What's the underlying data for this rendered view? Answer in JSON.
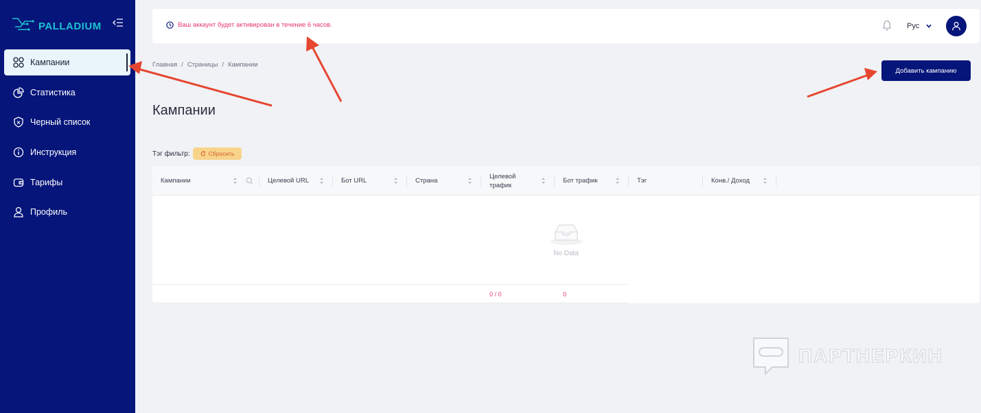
{
  "sidebar": {
    "logo_text": "PALLADIUM",
    "items": [
      {
        "label": "Кампании",
        "icon": "grid-circles-icon",
        "active": true
      },
      {
        "label": "Статистика",
        "icon": "pie-chart-icon",
        "active": false
      },
      {
        "label": "Черный список",
        "icon": "shield-icon",
        "active": false
      },
      {
        "label": "Инструкция",
        "icon": "info-icon",
        "active": false
      },
      {
        "label": "Тарифы",
        "icon": "wallet-icon",
        "active": false
      },
      {
        "label": "Профиль",
        "icon": "user-icon",
        "active": false
      }
    ]
  },
  "topbar": {
    "notice": "Ваш аккаунт будет активирован в течение 6 часов.",
    "language": "Рус"
  },
  "breadcrumb": [
    "Главная",
    "Страницы",
    "Кампании"
  ],
  "actions": {
    "add_campaign": "Добавить кампанию"
  },
  "page_title": "Кампании",
  "filter": {
    "label": "Тэг фильтр:",
    "reset": "Сбросить"
  },
  "table": {
    "columns": [
      "Кампании",
      "Целевой URL",
      "Бот URL",
      "Страна",
      "Целевой трафик",
      "Бот трафик",
      "Тэг",
      "Конв./ Доход"
    ],
    "empty_text": "No Data",
    "footer": {
      "target_traffic": "0 / 0",
      "bot_traffic": "0"
    }
  },
  "watermark": "ПАРТНЕРКИН",
  "colors": {
    "sidebar": "#05157a",
    "accent_red": "#e5386a",
    "reset": "#f8d48a"
  }
}
